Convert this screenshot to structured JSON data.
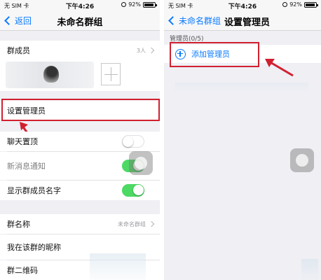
{
  "left_screen": {
    "status": {
      "carrier": "无 SIM 卡",
      "time": "下午4:26",
      "battery": "92%"
    },
    "nav": {
      "back_label": "返回",
      "title": "未命名群组"
    },
    "members": {
      "label": "群成员",
      "count": "3人"
    },
    "rows": {
      "set_admin": "设置管理员",
      "pin_chat": "聊天置顶",
      "mute": "新消息通知",
      "show_names": "显示群成员名字",
      "group_name": "群名称",
      "group_name_value": "未命名群组",
      "my_nickname": "我在该群的昵称",
      "qr_code": "群二维码"
    },
    "toggles": {
      "pin_chat": false,
      "mute": true,
      "show_names": true
    }
  },
  "right_screen": {
    "status": {
      "carrier": "无 SIM 卡",
      "time": "下午4:26",
      "battery": "92%"
    },
    "nav": {
      "back_label": "未命名群组",
      "title": "设置管理员"
    },
    "section_header": "管理员(0/5)",
    "add_admin_label": "添加管理员"
  },
  "colors": {
    "accent": "#0a7aff",
    "highlight": "#d1202f",
    "toggle_on": "#4cd964"
  }
}
